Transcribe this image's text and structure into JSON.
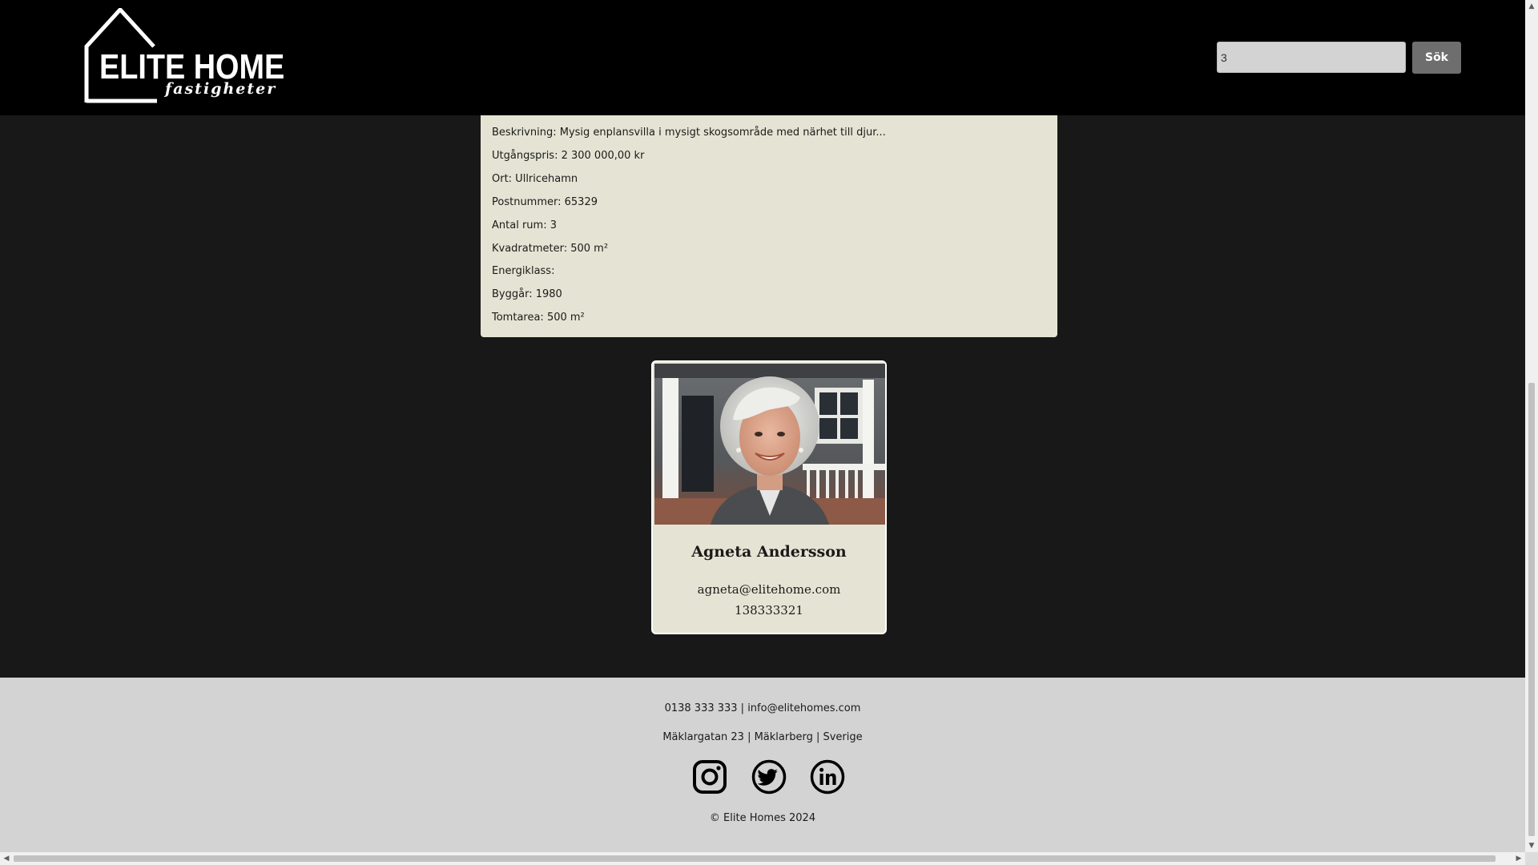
{
  "header": {
    "logo_title": "ELITE HOME",
    "logo_subtitle": "fastigheter",
    "search_value": "3",
    "search_button": "Sök"
  },
  "details": {
    "rows": [
      "Beskrivning: Mysig enplansvilla i mysigt skogsområde med närhet till djur...",
      "Utgångspris: 2 300 000,00 kr",
      "Ort: Ullricehamn",
      "Postnummer: 65329",
      "Antal rum: 3",
      "Kvadratmeter: 500 m²",
      "Energiklass:",
      "Byggår: 1980",
      "Tomtarea: 500 m²"
    ]
  },
  "agent": {
    "name": "Agneta Andersson",
    "email": "agneta@elitehome.com",
    "phone": "138333321"
  },
  "footer": {
    "contact": "0138 333 333 | info@elitehomes.com",
    "address": "Mäklargatan 23 | Mäklarberg | Sverige",
    "copyright": "© Elite Homes 2024",
    "social": [
      "instagram-icon",
      "twitter-icon",
      "linkedin-icon"
    ]
  },
  "colors": {
    "header_bg": "#000000",
    "page_bg": "#181818",
    "panel_bg": "#e5e4d4",
    "footer_bg": "#d3d3d3",
    "button_bg": "#6e6e6e"
  }
}
